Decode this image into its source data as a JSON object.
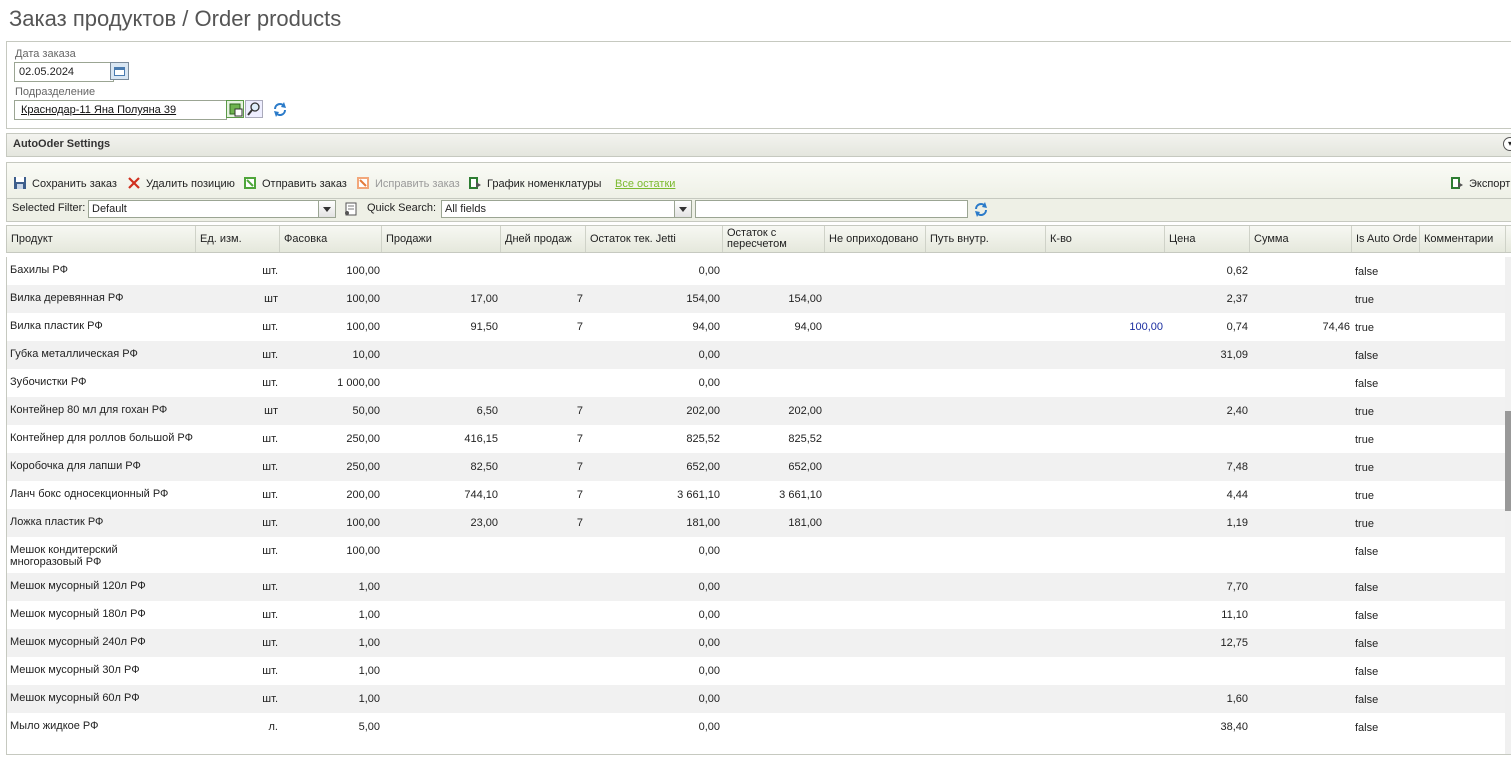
{
  "page": {
    "title": "Заказ продуктов / Order products"
  },
  "form": {
    "date_label": "Дата заказа",
    "date_value": "02.05.2024",
    "division_label": "Подразделение",
    "division_value": "Краснодар-11 Яна Полуяна 39"
  },
  "settings": {
    "label": "AutoOder Settings"
  },
  "toolbar": {
    "save": "Сохранить заказ",
    "delete": "Удалить позицию",
    "send": "Отправить заказ",
    "fix": "Исправить заказ",
    "schedule": "График номенклатуры",
    "all_stock": "Все остатки",
    "export": "Экспорт"
  },
  "filter": {
    "selected_filter_label": "Selected Filter:",
    "selected_filter_value": "Default",
    "quick_search_label": "Quick Search:",
    "quick_search_field": "All fields",
    "quick_search_text": ""
  },
  "columns": [
    "Продукт",
    "Ед. изм.",
    "Фасовка",
    "Продажи",
    "Дней продаж",
    "Остаток тек. Jetti",
    "Остаток с пересчетом",
    "Не оприходовано",
    "Путь внутр.",
    "К-во",
    "Цена",
    "Сумма",
    "Is Auto Orde",
    "Комментарии"
  ],
  "rows": [
    {
      "product": "Бахилы РФ",
      "unit": "шт.",
      "pack": "100,00",
      "sales": "",
      "days": "",
      "stock": "0,00",
      "recalc": "",
      "notrec": "",
      "path": "",
      "qty": "",
      "price": "0,62",
      "sum": "",
      "auto": "false"
    },
    {
      "product": "Вилка деревянная РФ",
      "unit": "шт",
      "pack": "100,00",
      "sales": "17,00",
      "days": "7",
      "stock": "154,00",
      "recalc": "154,00",
      "notrec": "",
      "path": "",
      "qty": "",
      "price": "2,37",
      "sum": "",
      "auto": "true"
    },
    {
      "product": "Вилка пластик РФ",
      "unit": "шт.",
      "pack": "100,00",
      "sales": "91,50",
      "days": "7",
      "stock": "94,00",
      "recalc": "94,00",
      "notrec": "",
      "path": "",
      "qty": "100,00",
      "price": "0,74",
      "sum": "74,46",
      "auto": "true"
    },
    {
      "product": "Губка металлическая РФ",
      "unit": "шт.",
      "pack": "10,00",
      "sales": "",
      "days": "",
      "stock": "0,00",
      "recalc": "",
      "notrec": "",
      "path": "",
      "qty": "",
      "price": "31,09",
      "sum": "",
      "auto": "false"
    },
    {
      "product": "Зубочистки РФ",
      "unit": "шт.",
      "pack": "1 000,00",
      "sales": "",
      "days": "",
      "stock": "0,00",
      "recalc": "",
      "notrec": "",
      "path": "",
      "qty": "",
      "price": "",
      "sum": "",
      "auto": "false"
    },
    {
      "product": "Контейнер 80 мл для гохан РФ",
      "unit": "шт",
      "pack": "50,00",
      "sales": "6,50",
      "days": "7",
      "stock": "202,00",
      "recalc": "202,00",
      "notrec": "",
      "path": "",
      "qty": "",
      "price": "2,40",
      "sum": "",
      "auto": "true"
    },
    {
      "product": "Контейнер для роллов большой РФ",
      "unit": "шт.",
      "pack": "250,00",
      "sales": "416,15",
      "days": "7",
      "stock": "825,52",
      "recalc": "825,52",
      "notrec": "",
      "path": "",
      "qty": "",
      "price": "",
      "sum": "",
      "auto": "true"
    },
    {
      "product": "Коробочка для лапши РФ",
      "unit": "шт.",
      "pack": "250,00",
      "sales": "82,50",
      "days": "7",
      "stock": "652,00",
      "recalc": "652,00",
      "notrec": "",
      "path": "",
      "qty": "",
      "price": "7,48",
      "sum": "",
      "auto": "true"
    },
    {
      "product": "Ланч бокс односекционный РФ",
      "unit": "шт.",
      "pack": "200,00",
      "sales": "744,10",
      "days": "7",
      "stock": "3 661,10",
      "recalc": "3 661,10",
      "notrec": "",
      "path": "",
      "qty": "",
      "price": "4,44",
      "sum": "",
      "auto": "true"
    },
    {
      "product": "Ложка пластик РФ",
      "unit": "шт.",
      "pack": "100,00",
      "sales": "23,00",
      "days": "7",
      "stock": "181,00",
      "recalc": "181,00",
      "notrec": "",
      "path": "",
      "qty": "",
      "price": "1,19",
      "sum": "",
      "auto": "true"
    },
    {
      "product": "Мешок кондитерский многоразовый РФ",
      "unit": "шт.",
      "pack": "100,00",
      "sales": "",
      "days": "",
      "stock": "0,00",
      "recalc": "",
      "notrec": "",
      "path": "",
      "qty": "",
      "price": "",
      "sum": "",
      "auto": "false"
    },
    {
      "product": "Мешок мусорный 120л РФ",
      "unit": "шт.",
      "pack": "1,00",
      "sales": "",
      "days": "",
      "stock": "0,00",
      "recalc": "",
      "notrec": "",
      "path": "",
      "qty": "",
      "price": "7,70",
      "sum": "",
      "auto": "false"
    },
    {
      "product": "Мешок мусорный 180л РФ",
      "unit": "шт.",
      "pack": "1,00",
      "sales": "",
      "days": "",
      "stock": "0,00",
      "recalc": "",
      "notrec": "",
      "path": "",
      "qty": "",
      "price": "11,10",
      "sum": "",
      "auto": "false"
    },
    {
      "product": "Мешок мусорный 240л РФ",
      "unit": "шт.",
      "pack": "1,00",
      "sales": "",
      "days": "",
      "stock": "0,00",
      "recalc": "",
      "notrec": "",
      "path": "",
      "qty": "",
      "price": "12,75",
      "sum": "",
      "auto": "false"
    },
    {
      "product": "Мешок мусорный 30л РФ",
      "unit": "шт.",
      "pack": "1,00",
      "sales": "",
      "days": "",
      "stock": "0,00",
      "recalc": "",
      "notrec": "",
      "path": "",
      "qty": "",
      "price": "",
      "sum": "",
      "auto": "false"
    },
    {
      "product": "Мешок мусорный 60л РФ",
      "unit": "шт.",
      "pack": "1,00",
      "sales": "",
      "days": "",
      "stock": "0,00",
      "recalc": "",
      "notrec": "",
      "path": "",
      "qty": "",
      "price": "1,60",
      "sum": "",
      "auto": "false"
    },
    {
      "product": "Мыло жидкое РФ",
      "unit": "л.",
      "pack": "5,00",
      "sales": "",
      "days": "",
      "stock": "0,00",
      "recalc": "",
      "notrec": "",
      "path": "",
      "qty": "",
      "price": "38,40",
      "sum": "",
      "auto": "false"
    }
  ]
}
